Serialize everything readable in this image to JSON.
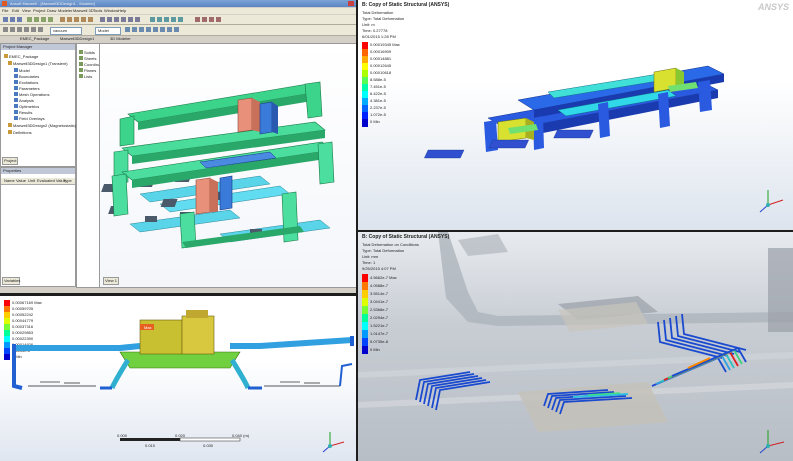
{
  "hfss": {
    "title": "Ansoft Maxwell - [Maxwell3DDesign1 - Modeler]",
    "tabs": [
      "EMEC_Package",
      "Maxwell3DDesign1",
      "3D Modeler",
      "EMEC_Package"
    ],
    "menu": [
      "File",
      "Edit",
      "View",
      "Project",
      "Draw",
      "Modeler",
      "Maxwell 3D",
      "Tools",
      "Window",
      "Help"
    ],
    "toolbar_select1": "vacuum",
    "toolbar_select2": "Model",
    "project_manager_title": "Project Manager",
    "project_tree": [
      "EMEC_Package",
      "Maxwell3DDesign1 (Transient)",
      "Model",
      "Boundaries",
      "Excitations",
      "Parameters",
      "Mesh Operations",
      "Analysis",
      "Optimetrics",
      "Results",
      "Field Overlays",
      "Maxwell3DDesign2 (Magnetostatic)",
      "Definitions"
    ],
    "project_tab": "Project",
    "properties_title": "Properties",
    "properties_headers": [
      "Name",
      "Value",
      "Unit",
      "Evaluated Value",
      "Type"
    ],
    "variables_tab": "Variables",
    "model_tree": [
      "Solids",
      "Sheets",
      "Coordinate",
      "Planes",
      "Lists"
    ],
    "viewport_label": "View 1"
  },
  "ansys_top": {
    "title": "B: Copy of Static Structural (ANSYS)",
    "info": [
      "Total Deformation",
      "Type: Total Deformation",
      "Unit: m",
      "Time: 0.27778",
      "6/01/2015 1:28 PM"
    ],
    "legend": [
      "0.00019345 Max",
      "0.00016909",
      "0.00014881",
      "0.00012645",
      "0.00010618",
      "8.588e-5",
      "7.451e-5",
      "6.422e-5",
      "4.381e-5",
      "2.237e-5",
      "1.072e-5",
      "0 Min"
    ],
    "brand": "ANSYS"
  },
  "ansys_bottom_left": {
    "title": "0.00067169 Max",
    "legend": [
      "0.00067169 Max",
      "0.00059705",
      "0.00052242",
      "0.00044779",
      "0.00037316",
      "0.00029853",
      "0.00022390",
      "0.00014926",
      "7.4633e-5",
      "0 Min"
    ],
    "max_label": "Max",
    "scale_ticks": [
      "0.000",
      "0.020",
      "0.040 (m)"
    ],
    "scale_mid": [
      "0.010",
      "0.030"
    ]
  },
  "ansys_bottom_right": {
    "title": "B: Copy of Static Structural (ANSYS)",
    "info": [
      "Total Deformation on Conditions",
      "Type: Total Deformation",
      "Unit: mm",
      "Time: 1",
      "9/25/2015 4:07 PM"
    ],
    "legend": [
      "4.5662e-7 Max",
      "4.0588e-7",
      "3.5514e-7",
      "3.0441e-7",
      "2.5368e-7",
      "2.0294e-7",
      "1.5221e-7",
      "1.0147e-7",
      "5.0735e-8",
      "0 Min"
    ]
  },
  "colors": {
    "legend": [
      "#ff0000",
      "#ff5500",
      "#ffaa00",
      "#ffff00",
      "#aaff00",
      "#55ff00",
      "#00ff55",
      "#00ffaa",
      "#00ffff",
      "#00aaff",
      "#0055ff",
      "#0000ff"
    ]
  }
}
